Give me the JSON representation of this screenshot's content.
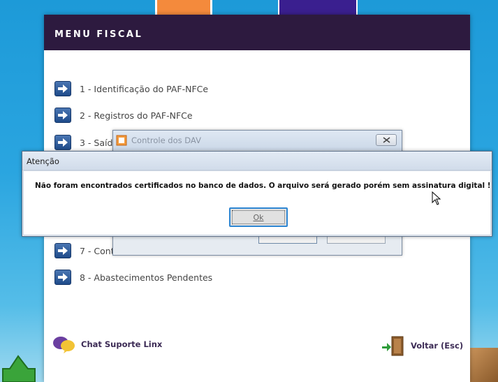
{
  "menu": {
    "title": "MENU FISCAL",
    "items": [
      {
        "label": "1 - Identificação do PAF-NFCe"
      },
      {
        "label": "2 - Registros do PAF-NFCe"
      },
      {
        "label": "3 - Saíd"
      },
      {
        "label": "7 - Cont"
      },
      {
        "label": "8 - Abastecimentos Pendentes"
      }
    ]
  },
  "footer": {
    "chat_label": "Chat Suporte Linx",
    "back_label": "Voltar (Esc)"
  },
  "dav_dialog": {
    "title": "Controle dos DAV"
  },
  "alert": {
    "title": "Atenção",
    "message": "Não foram encontrados certificados no banco de dados. O arquivo será gerado porém sem assinatura digital !",
    "ok_label": "Ok"
  },
  "colors": {
    "header_bg": "#2d1a3f",
    "accent_blue": "#2e86d2",
    "arrow_icon": "#2a5a9e"
  }
}
